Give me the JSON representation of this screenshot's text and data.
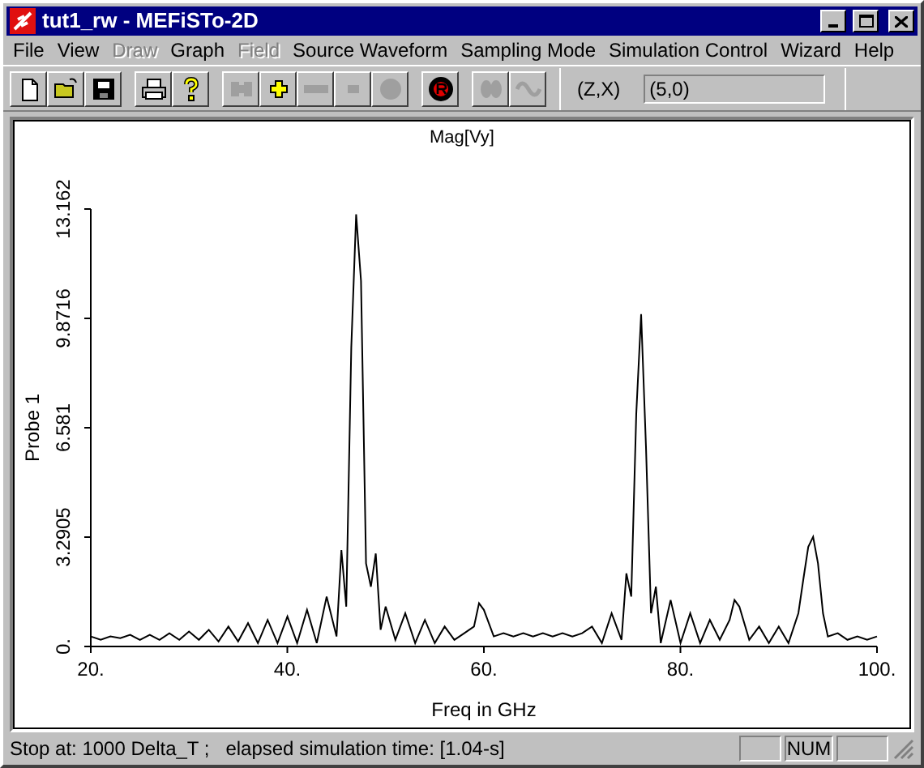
{
  "window": {
    "title": "tut1_rw - MEFiSTo-2D"
  },
  "menu": [
    {
      "label": "File",
      "disabled": false
    },
    {
      "label": "View",
      "disabled": false
    },
    {
      "label": "Draw",
      "disabled": true
    },
    {
      "label": "Graph",
      "disabled": false
    },
    {
      "label": "Field",
      "disabled": true
    },
    {
      "label": "Source Waveform",
      "disabled": false
    },
    {
      "label": "Sampling Mode",
      "disabled": false
    },
    {
      "label": "Simulation Control",
      "disabled": false
    },
    {
      "label": "Wizard",
      "disabled": false
    },
    {
      "label": "Help",
      "disabled": false
    }
  ],
  "toolbar": [
    [
      {
        "kind": "new",
        "disabled": false
      },
      {
        "kind": "open",
        "disabled": false
      },
      {
        "kind": "save",
        "disabled": false
      }
    ],
    [
      {
        "kind": "print",
        "disabled": false
      },
      {
        "kind": "help",
        "disabled": false
      }
    ],
    [
      {
        "kind": "wall",
        "disabled": true
      },
      {
        "kind": "plus",
        "disabled": false
      },
      {
        "kind": "line",
        "disabled": true
      },
      {
        "kind": "minus",
        "disabled": true
      },
      {
        "kind": "dot",
        "disabled": true
      }
    ],
    [
      {
        "kind": "record",
        "disabled": false
      }
    ],
    [
      {
        "kind": "pair",
        "disabled": true
      },
      {
        "kind": "wave",
        "disabled": true
      }
    ]
  ],
  "coordinates": {
    "label": "(Z,X)",
    "value": "(5,0)"
  },
  "chart_data": {
    "type": "line",
    "title": "Mag[Vy]",
    "xlabel": "Freq in GHz",
    "ylabel": "Probe 1",
    "x": [
      20,
      21,
      22,
      23,
      24,
      25,
      26,
      27,
      28,
      29,
      30,
      31,
      32,
      33,
      34,
      35,
      36,
      37,
      38,
      39,
      40,
      41,
      42,
      43,
      44,
      45,
      45.5,
      46,
      46.5,
      47,
      47.5,
      48,
      48.5,
      49,
      49.5,
      50,
      51,
      52,
      53,
      54,
      55,
      56,
      57,
      58,
      59,
      59.5,
      60,
      61,
      62,
      63,
      64,
      65,
      66,
      67,
      68,
      69,
      70,
      71,
      72,
      73,
      74,
      74.5,
      75,
      75.5,
      76,
      76.5,
      77,
      77.5,
      78,
      79,
      80,
      81,
      82,
      83,
      84,
      85,
      85.5,
      86,
      87,
      88,
      89,
      90,
      91,
      92,
      92.5,
      93,
      93.5,
      94,
      94.5,
      95,
      96,
      97,
      98,
      99,
      100
    ],
    "series": [
      {
        "color": "#000000",
        "values": [
          0.3,
          0.2,
          0.3,
          0.25,
          0.35,
          0.2,
          0.35,
          0.2,
          0.4,
          0.2,
          0.45,
          0.2,
          0.5,
          0.15,
          0.6,
          0.15,
          0.7,
          0.1,
          0.8,
          0.1,
          0.9,
          0.1,
          1.1,
          0.1,
          1.5,
          0.3,
          2.9,
          1.2,
          9,
          13,
          11,
          2.5,
          1.8,
          2.8,
          0.5,
          1.2,
          0.2,
          1,
          0.1,
          0.8,
          0.1,
          0.6,
          0.2,
          0.4,
          0.6,
          1.3,
          1.1,
          0.3,
          0.4,
          0.3,
          0.4,
          0.3,
          0.4,
          0.3,
          0.4,
          0.3,
          0.4,
          0.6,
          0.1,
          1,
          0.2,
          2.2,
          1.5,
          7,
          10,
          6,
          1,
          1.8,
          0.1,
          1.4,
          0.1,
          1,
          0.1,
          0.8,
          0.2,
          0.8,
          1.4,
          1.2,
          0.2,
          0.6,
          0.1,
          0.6,
          0.1,
          1,
          2,
          3,
          3.3,
          2.5,
          1,
          0.3,
          0.4,
          0.2,
          0.3,
          0.2,
          0.3
        ]
      }
    ],
    "xlim": [
      20,
      100
    ],
    "ylim": [
      0,
      13.162
    ],
    "xticks": [
      {
        "value": 20,
        "label": "20."
      },
      {
        "value": 40,
        "label": "40."
      },
      {
        "value": 60,
        "label": "60."
      },
      {
        "value": 80,
        "label": "80."
      },
      {
        "value": 100,
        "label": "100."
      }
    ],
    "yticks": [
      {
        "value": 0,
        "label": "0."
      },
      {
        "value": 3.2905,
        "label": "3.2905"
      },
      {
        "value": 6.581,
        "label": "6.581"
      },
      {
        "value": 9.8716,
        "label": "9.8716"
      },
      {
        "value": 13.162,
        "label": "13.162"
      }
    ]
  },
  "status_bar": {
    "message": "Stop at: 1000 Delta_T ;   elapsed simulation time: [1.04-s]",
    "indicator": "NUM"
  }
}
